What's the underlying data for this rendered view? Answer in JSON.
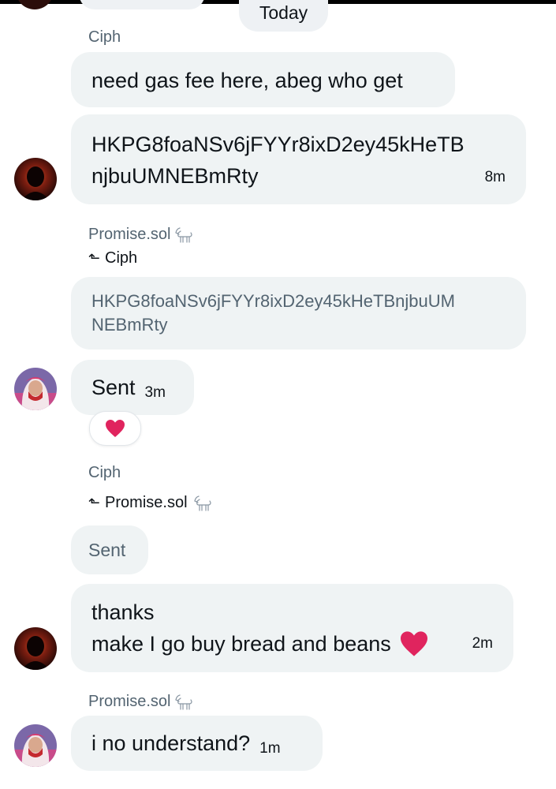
{
  "chat": {
    "date_divider": "Today",
    "messages": [
      {
        "sender": "Ciph",
        "text": "need gas fee here, abeg who get"
      },
      {
        "text_line1": "HKPG8foaNSv6jFYYr8ixD2ey45kHeTB",
        "text_line2": "njbuUMNEBmRty",
        "time": "8m"
      },
      {
        "sender": "Promise.sol",
        "reply_to": "Ciph",
        "quoted_line1": "HKPG8foaNSv6jFYYr8ixD2ey45kHeTBnjbuUM",
        "quoted_line2": "NEBmRty",
        "text": "Sent",
        "time": "3m",
        "reaction": "heart-emoji"
      },
      {
        "sender": "Ciph",
        "reply_to": "Promise.sol",
        "quoted": "Sent",
        "text_line1": "thanks",
        "text_line2": "make I go buy bread and beans",
        "time": "2m"
      },
      {
        "sender": "Promise.sol",
        "text": "i no understand?",
        "time": "1m"
      }
    ]
  },
  "colors": {
    "bubble": "#eff3f4",
    "secondary_text": "#536471",
    "heart": "#e0245e"
  }
}
